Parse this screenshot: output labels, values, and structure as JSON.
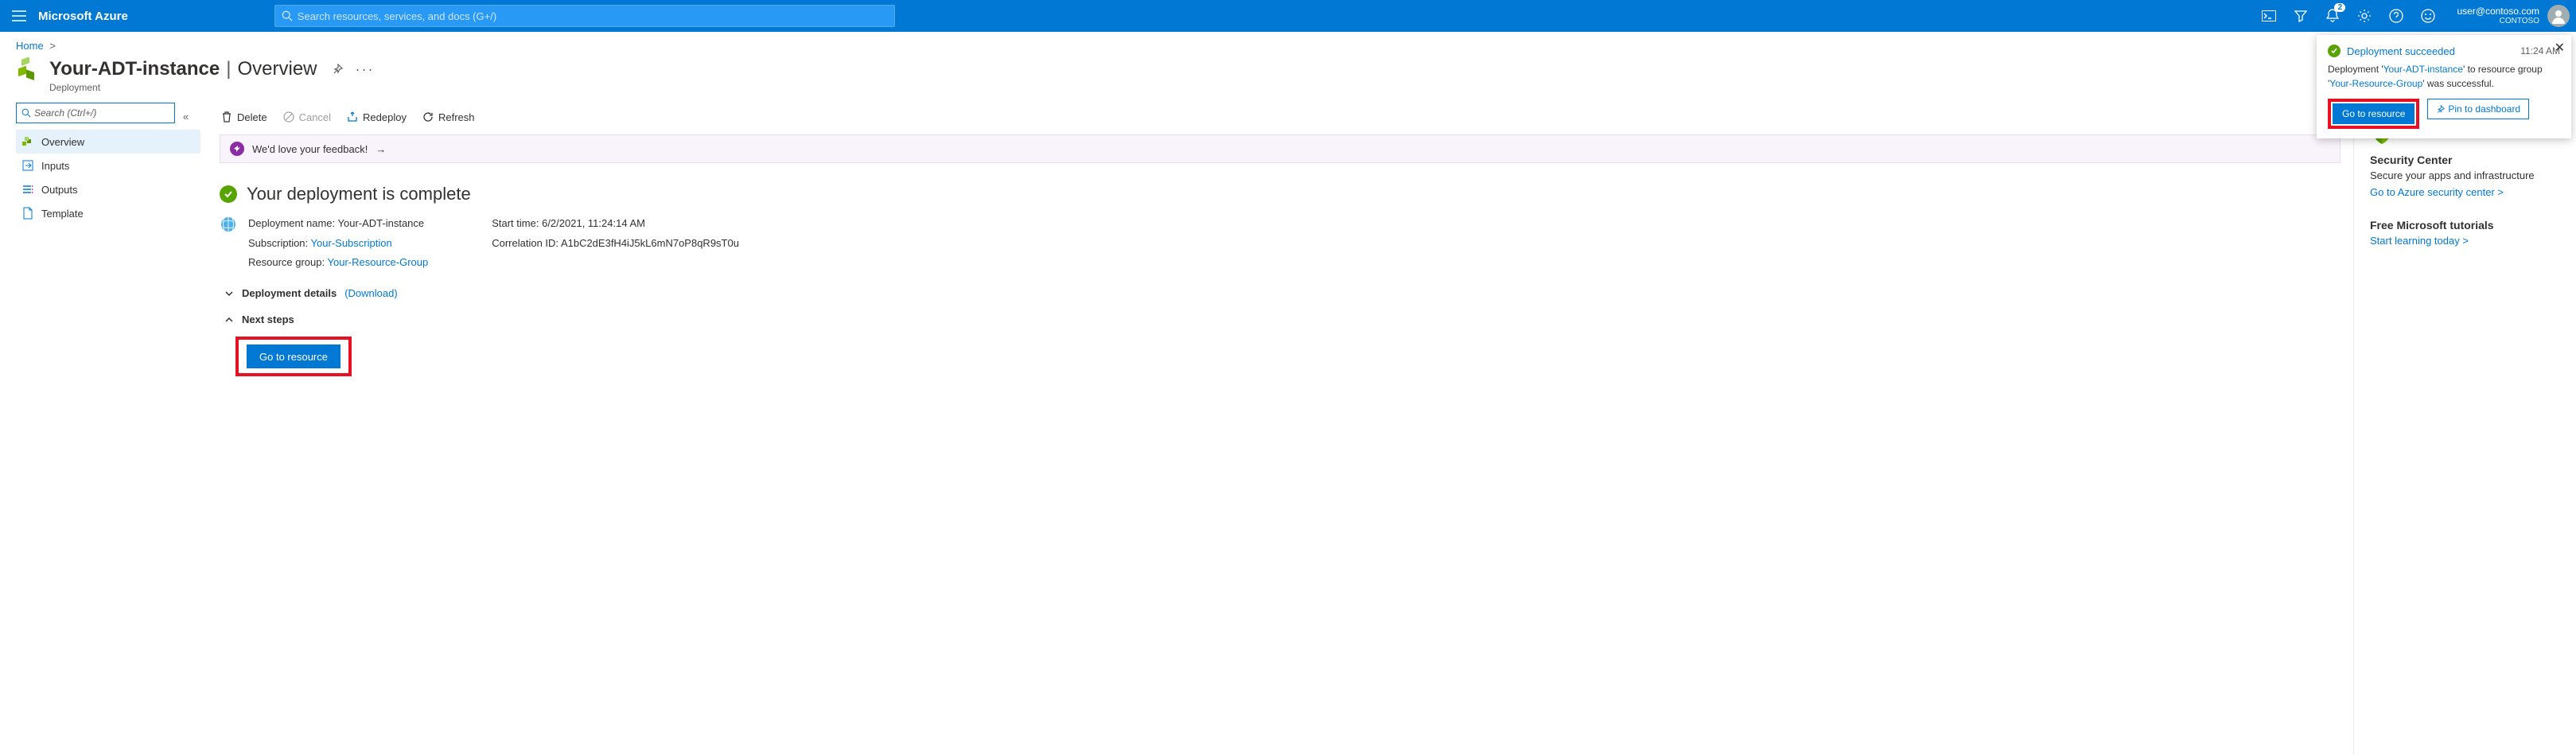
{
  "topbar": {
    "brand": "Microsoft Azure",
    "search_placeholder": "Search resources, services, and docs (G+/)",
    "notification_count": "2",
    "account_email": "user@contoso.com",
    "account_tenant": "CONTOSO"
  },
  "breadcrumb": {
    "home": "Home"
  },
  "title": {
    "name": "Your-ADT-instance",
    "section": "Overview",
    "type": "Deployment"
  },
  "sidebar": {
    "search_placeholder": "Search (Ctrl+/)",
    "items": [
      {
        "label": "Overview",
        "icon": "overview"
      },
      {
        "label": "Inputs",
        "icon": "inputs"
      },
      {
        "label": "Outputs",
        "icon": "outputs"
      },
      {
        "label": "Template",
        "icon": "template"
      }
    ]
  },
  "toolbar": {
    "delete": "Delete",
    "cancel": "Cancel",
    "redeploy": "Redeploy",
    "refresh": "Refresh"
  },
  "feedback": {
    "text": "We'd love your feedback!"
  },
  "status": {
    "title": "Your deployment is complete"
  },
  "details": {
    "deployment_label": "Deployment name:",
    "deployment_value": "Your-ADT-instance",
    "subscription_label": "Subscription:",
    "subscription_value": "Your-Subscription",
    "rg_label": "Resource group:",
    "rg_value": "Your-Resource-Group",
    "start_label": "Start time:",
    "start_value": "6/2/2021, 11:24:14 AM",
    "corr_label": "Correlation ID:",
    "corr_value": "A1bC2dE3fH4iJ5kL6mN7oP8qR9sT0u"
  },
  "expanders": {
    "details_label": "Deployment details",
    "details_link": "(Download)",
    "next_label": "Next steps",
    "go_button": "Go to resource"
  },
  "rightcol": {
    "sec_title": "Security Center",
    "sec_text": "Secure your apps and infrastructure",
    "sec_link": "Go to Azure security center >",
    "tut_title": "Free Microsoft tutorials",
    "tut_link": "Start learning today >"
  },
  "toast": {
    "title": "Deployment succeeded",
    "time": "11:24 AM",
    "body_pre": "Deployment '",
    "body_dep": "Your-ADT-instance",
    "body_mid": "' to resource group '",
    "body_rg": "Your-Resource-Group",
    "body_post": "' was successful.",
    "go": "Go to resource",
    "pin": "Pin to dashboard"
  }
}
